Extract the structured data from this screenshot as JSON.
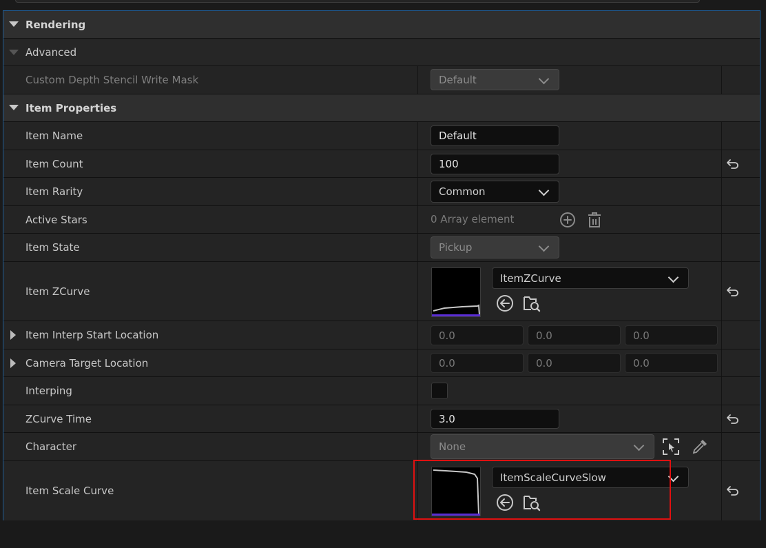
{
  "sections": {
    "rendering": "Rendering",
    "advanced": "Advanced",
    "item_properties": "Item Properties"
  },
  "rendering": {
    "custom_depth_label": "Custom Depth Stencil Write Mask",
    "custom_depth_value": "Default"
  },
  "props": {
    "item_name": {
      "label": "Item Name",
      "value": "Default"
    },
    "item_count": {
      "label": "Item Count",
      "value": "100"
    },
    "item_rarity": {
      "label": "Item Rarity",
      "value": "Common"
    },
    "active_stars": {
      "label": "Active Stars",
      "value": "0 Array element"
    },
    "item_state": {
      "label": "Item State",
      "value": "Pickup"
    },
    "item_zcurve": {
      "label": "Item ZCurve",
      "value": "ItemZCurve"
    },
    "interp_start": {
      "label": "Item Interp Start Location",
      "x": "0.0",
      "y": "0.0",
      "z": "0.0"
    },
    "camera_target": {
      "label": "Camera Target Location",
      "x": "0.0",
      "y": "0.0",
      "z": "0.0"
    },
    "interping": {
      "label": "Interping",
      "checked": false
    },
    "zcurve_time": {
      "label": "ZCurve Time",
      "value": "3.0"
    },
    "character": {
      "label": "Character",
      "value": "None"
    },
    "item_scale_curve": {
      "label": "Item Scale Curve",
      "value": "ItemScaleCurveSlow"
    }
  },
  "icons": {
    "reset": "reset-arrow-icon",
    "add": "add-circle-icon",
    "delete": "trash-icon",
    "use_selected": "use-selected-arrow-icon",
    "browse": "browse-folder-icon",
    "pick_actor": "pick-actor-icon",
    "eyedropper": "eyedropper-icon"
  },
  "colors": {
    "accent_border": "#1f5e98",
    "highlight": "#e01010",
    "curve_bar": "#5a2dd4"
  }
}
